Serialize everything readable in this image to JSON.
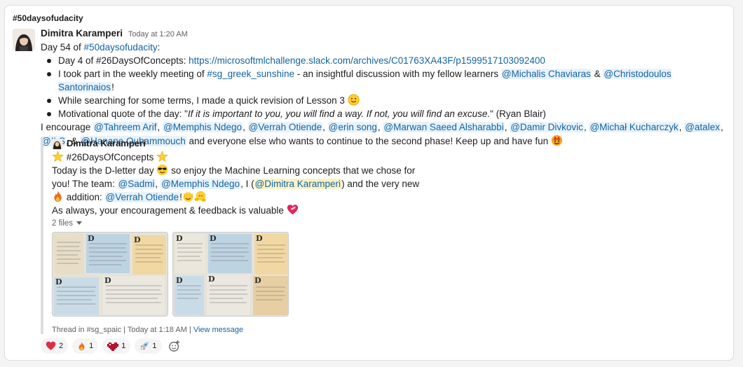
{
  "channel": "#50daysofudacity",
  "message": {
    "author": "Dimitra Karamperi",
    "time": "Today at 1:20 AM",
    "day_prefix": "Day 54 of ",
    "day_channel": "#50daysofudacity",
    "day_suffix": ":",
    "bullet1_text": "Day 4 of #26DaysOfConcepts: ",
    "bullet1_link": "https://microsoftmlchallenge.slack.com/archives/C01763XA43F/p1599517103092400",
    "bullet2_pre": "I took part in the weekly meeting of ",
    "bullet2_channel": "#sg_greek_sunshine",
    "bullet2_mid": " - an insightful discussion with my fellow learners ",
    "bullet2_m1": "@Michalis Chaviaras",
    "bullet2_amp": " & ",
    "bullet2_m2": "@Christodoulos Santorinaios",
    "bullet2_end": "!",
    "bullet3_text": "While searching for some terms, I made a quick revision of Lesson 3 ",
    "bullet4_pre": "Motivational quote of the day: \"",
    "bullet4_quote": "If it is important to you, you will find a way. If not, you will find an excuse.",
    "bullet4_post": "\" (Ryan Blair)",
    "enc_pre": "I encourage ",
    "mentions": [
      "@Tahreem Arif",
      "@Memphis Ndego",
      "@Verrah Otiende",
      "@erin song",
      "@Marwan Saeed Alsharabbi",
      "@Damir Divkovic",
      "@Michał Kucharczyk",
      "@atalex"
    ],
    "mention_ils": "@ILS",
    "amp": ", & ",
    "mention_hanane": "@Hanane Ouhammouch",
    "enc_post": " and everyone else who wants to continue to the second phase! Keep up and have fun "
  },
  "quote": {
    "author": "Dimitra Karamperi",
    "title": " #26DaysOfConcepts ",
    "line1_pre": "Today is the D-letter day ",
    "line1_post": " so enjoy the Machine Learning concepts that we chose for",
    "line2_pre": "you! The team: ",
    "m_sadmi": "@Sadmi",
    "m_memphis": "@Memphis Ndego",
    "line2_mid": ", I (",
    "m_self": "@Dimitra Karamperi",
    "line2_post": ") and the very new",
    "line3_pre": " addition: ",
    "m_verrah": "@Verrah Otiende",
    "line3_post": "!",
    "line4": "As always, your encouragement & feedback is valuable ",
    "files": "2 files",
    "thread_pre": "Thread in #sg_spaic | Today at 1:18 AM | ",
    "view_message": "View message"
  },
  "reactions": [
    {
      "icon": "heart-icon",
      "count": "2"
    },
    {
      "icon": "fire-icon",
      "count": "1"
    },
    {
      "icon": "heart-pixel-icon",
      "count": "1"
    },
    {
      "icon": "rocket-icon",
      "count": "1"
    }
  ],
  "colors": {
    "link": "#1264a3",
    "mention_bg": "#e8f2fb",
    "self_mention_bg": "#fdf2c5"
  }
}
